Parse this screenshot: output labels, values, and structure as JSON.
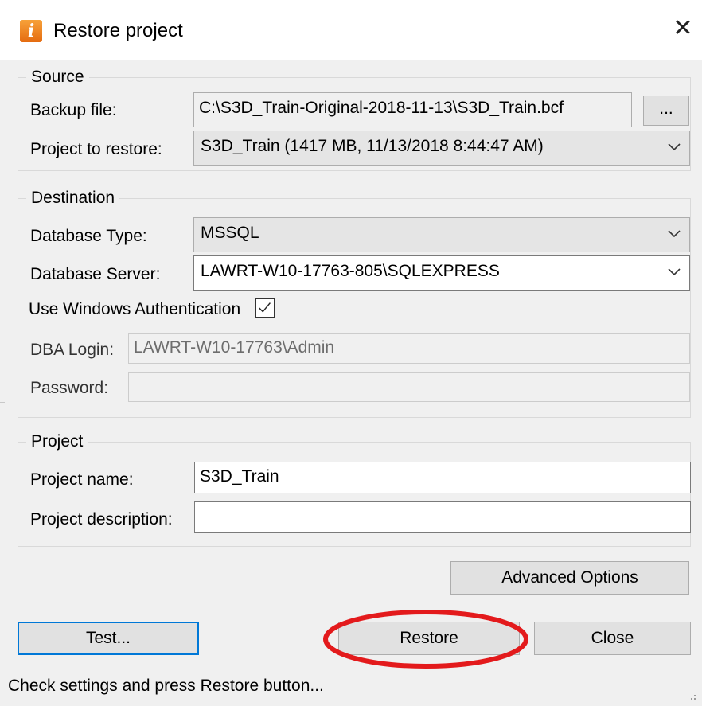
{
  "window": {
    "title": "Restore project",
    "close_glyph": "✕"
  },
  "source": {
    "legend": "Source",
    "backup_label": "Backup file:",
    "backup_value": "C:\\S3D_Train-Original-2018-11-13\\S3D_Train.bcf",
    "browse_label": "...",
    "project_label": "Project to restore:",
    "project_value": "S3D_Train (1417 MB, 11/13/2018 8:44:47 AM)"
  },
  "destination": {
    "legend": "Destination",
    "db_type_label": "Database Type:",
    "db_type_value": "MSSQL",
    "db_server_label": "Database Server:",
    "db_server_value": "LAWRT-W10-17763-805\\SQLEXPRESS",
    "win_auth_label": "Use Windows Authentication",
    "win_auth_checked": true,
    "dba_login_label": "DBA Login:",
    "dba_login_value": "LAWRT-W10-17763\\Admin",
    "password_label": "Password:",
    "password_value": ""
  },
  "project": {
    "legend": "Project",
    "name_label": "Project name:",
    "name_value": "S3D_Train",
    "description_label": "Project description:",
    "description_value": ""
  },
  "buttons": {
    "advanced": "Advanced Options",
    "test": "Test...",
    "restore": "Restore",
    "close": "Close"
  },
  "status": {
    "text": "Check settings and press Restore button..."
  },
  "icons": {
    "app": "info-icon",
    "close": "close-icon",
    "dropdown": "chevron-down-icon",
    "check": "checkmark-icon",
    "grip": "resize-grip-icon"
  },
  "colors": {
    "default_button_border": "#0078d7",
    "highlight_ellipse": "#e31a1c",
    "app_icon": "#e56b10"
  }
}
